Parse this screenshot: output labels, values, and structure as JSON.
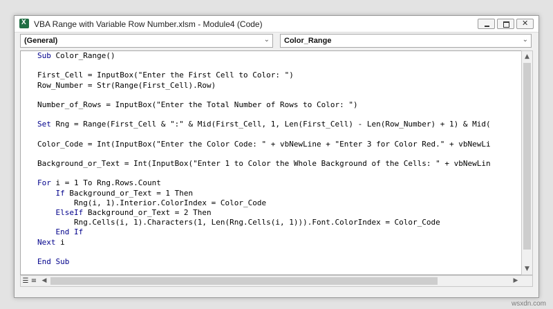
{
  "window": {
    "title": "VBA Range with Variable Row Number.xlsm - Module4 (Code)",
    "controls": {
      "minimize": "minimize",
      "maximize": "maximize",
      "close": "close"
    }
  },
  "combos": {
    "object": {
      "value": "(General)"
    },
    "procedure": {
      "value": "Color_Range"
    }
  },
  "code": {
    "lines": [
      {
        "kw": "Sub ",
        "text": "Color_Range()"
      },
      {
        "kw": "",
        "text": ""
      },
      {
        "kw": "",
        "text": "First_Cell = InputBox(\"Enter the First Cell to Color: \")"
      },
      {
        "kw": "",
        "text": "Row_Number = Str(Range(First_Cell).Row)"
      },
      {
        "kw": "",
        "text": ""
      },
      {
        "kw": "",
        "text": "Number_of_Rows = InputBox(\"Enter the Total Number of Rows to Color: \")"
      },
      {
        "kw": "",
        "text": ""
      },
      {
        "kw": "Set ",
        "text": "Rng = Range(First_Cell & \":\" & Mid(First_Cell, 1, Len(First_Cell) - Len(Row_Number) + 1) & Mid("
      },
      {
        "kw": "",
        "text": ""
      },
      {
        "kw": "",
        "text": "Color_Code = Int(InputBox(\"Enter the Color Code: \" + vbNewLine + \"Enter 3 for Color Red.\" + vbNewLi"
      },
      {
        "kw": "",
        "text": ""
      },
      {
        "kw": "",
        "text": "Background_or_Text = Int(InputBox(\"Enter 1 to Color the Whole Background of the Cells: \" + vbNewLin"
      },
      {
        "kw": "",
        "text": ""
      },
      {
        "kw": "For ",
        "text": "i = 1 To Rng.Rows.Count"
      },
      {
        "kw": "    If ",
        "text": "Background_or_Text = 1 Then"
      },
      {
        "kw": "",
        "text": "        Rng(i, 1).Interior.ColorIndex = Color_Code"
      },
      {
        "kw": "    ElseIf ",
        "text": "Background_or_Text = 2 Then"
      },
      {
        "kw": "",
        "text": "        Rng.Cells(i, 1).Characters(1, Len(Rng.Cells(i, 1))).Font.ColorIndex = Color_Code"
      },
      {
        "kw": "    End If",
        "text": ""
      },
      {
        "kw": "Next ",
        "text": "i"
      },
      {
        "kw": "",
        "text": ""
      },
      {
        "kw": "End Sub",
        "text": ""
      }
    ]
  },
  "icons": {
    "app": "excel-icon",
    "dropdown": "chevron-down-icon",
    "procedure_view": "procedure-view-icon",
    "full_module_view": "full-module-view-icon"
  },
  "colors": {
    "keyword": "#00008b",
    "code_text": "#000000",
    "editor_bg": "#ffffff",
    "chrome_bg": "#f0f0f0"
  },
  "watermark": "wsxdn.com"
}
